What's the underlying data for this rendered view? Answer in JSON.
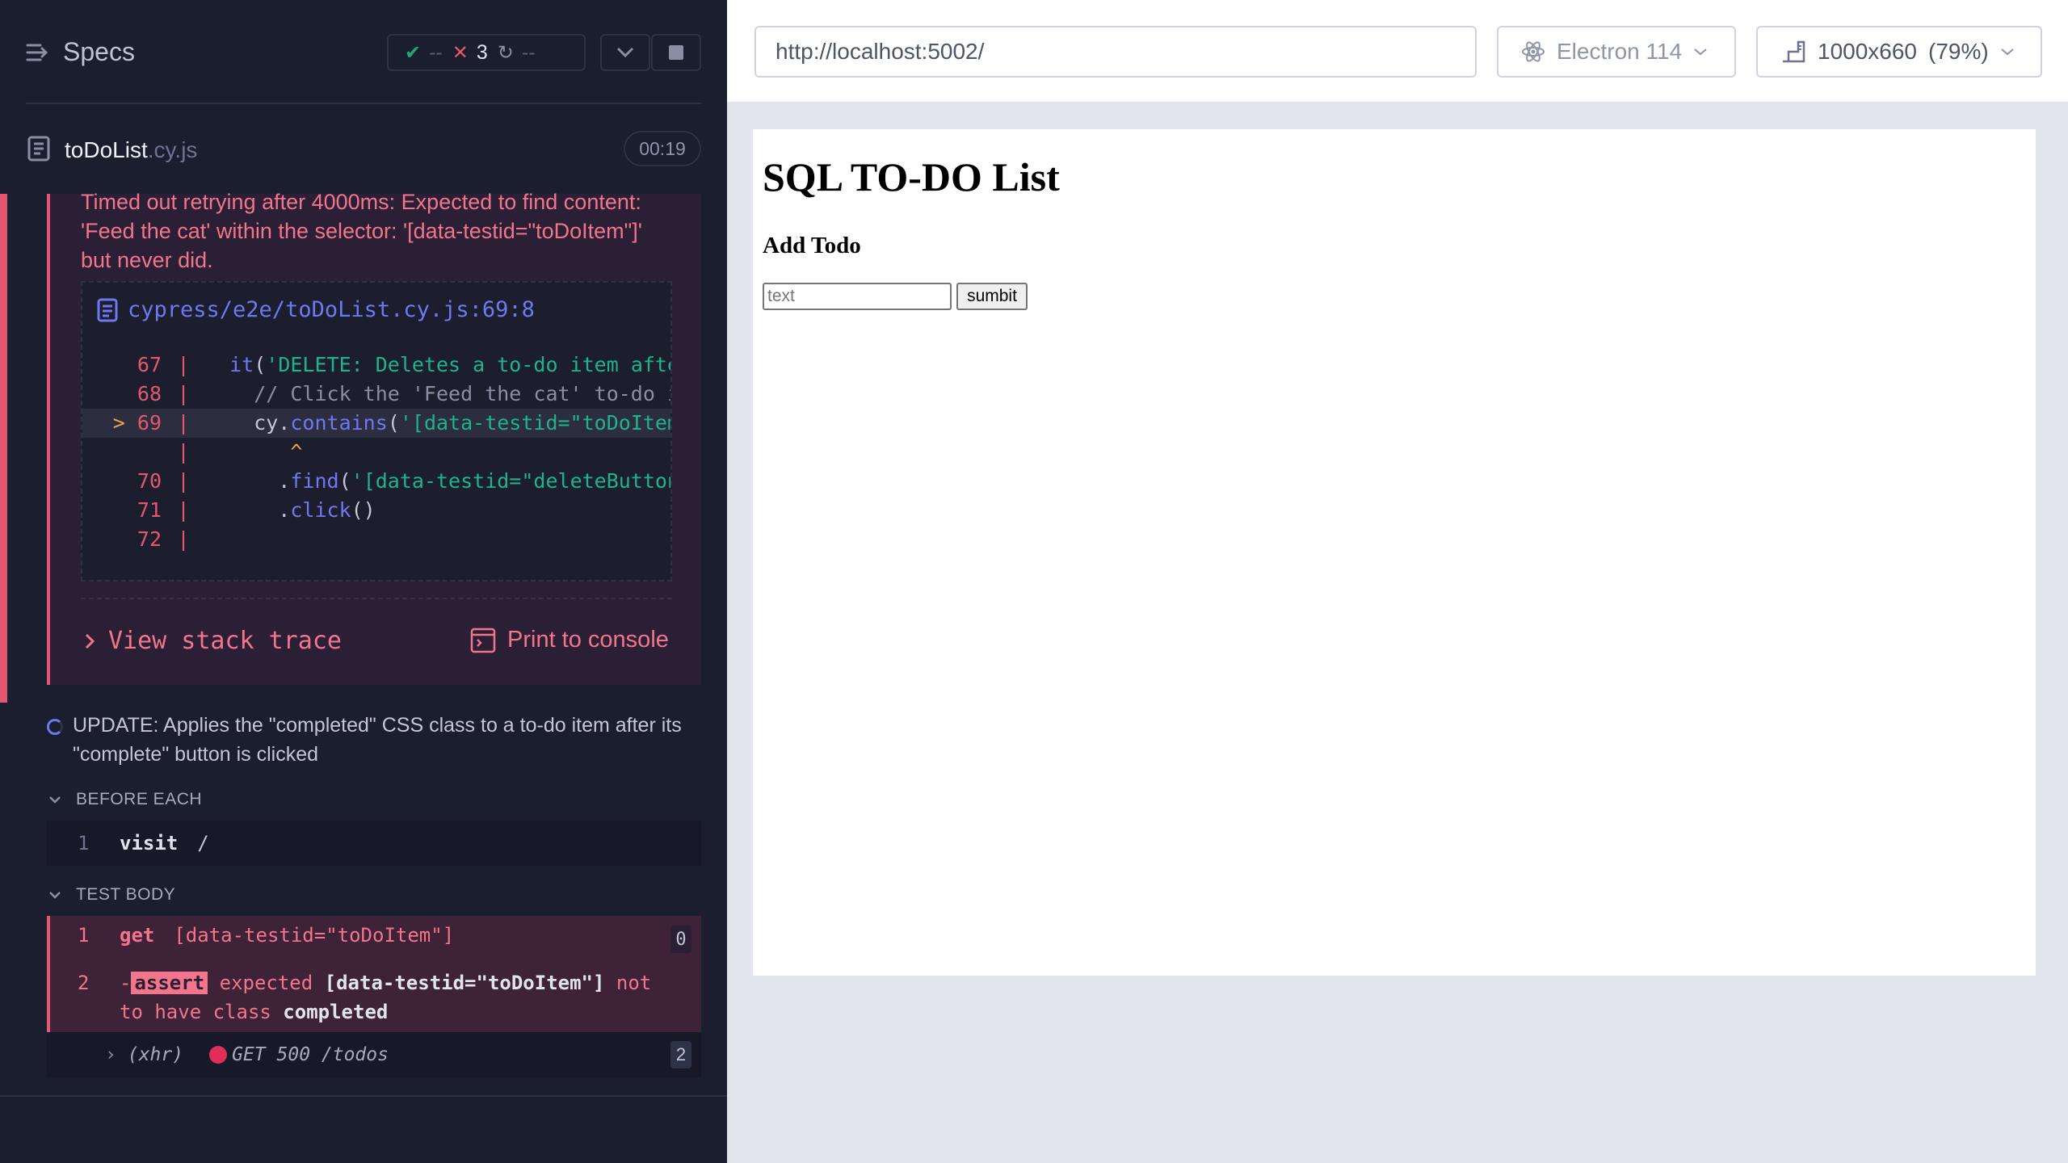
{
  "reporter": {
    "specs_label": "Specs",
    "stats": {
      "passed": "--",
      "failed": "3",
      "pending": "--"
    },
    "spec": {
      "name": "toDoList",
      "ext": ".cy.js",
      "duration": "00:19"
    },
    "error": {
      "message": "Timed out retrying after 4000ms: Expected to find content: 'Feed the cat' within the selector: '[data-testid=\"toDoItem\"]' but never did.",
      "file": "cypress/e2e/toDoList.cy.js:69:8",
      "view_stack_trace": "View stack trace",
      "print_to_console": "Print to console"
    },
    "test2": {
      "title": "UPDATE: Applies the \"completed\" CSS class to a to-do item after its \"complete\" button is clicked",
      "before_each_label": "BEFORE EACH",
      "test_body_label": "TEST BODY",
      "visit": {
        "num": "1",
        "name": "visit",
        "msg": "/"
      },
      "get": {
        "num": "1",
        "name": "get",
        "msg": "[data-testid=\"toDoItem\"]",
        "count": "0"
      },
      "assert": {
        "num": "2",
        "tag": "assert",
        "w1": "expected",
        "w2": "[data-testid=\"toDoItem\"]",
        "w3": "not to have class",
        "w4": "completed"
      },
      "xhr": {
        "type": "(xhr)",
        "status": "GET 500 /todos",
        "count": "2"
      }
    }
  },
  "aut": {
    "url": "http://localhost:5002/",
    "browser": "Electron 114",
    "viewport": "1000x660",
    "zoom": "(79%)"
  },
  "app": {
    "title": "SQL TO-DO List",
    "subtitle": "Add Todo",
    "input_placeholder": "text",
    "submit_label": "sumbit"
  },
  "colors": {
    "fail": "#e45770",
    "pass": "#1fa971",
    "accent": "#6f78f0"
  }
}
